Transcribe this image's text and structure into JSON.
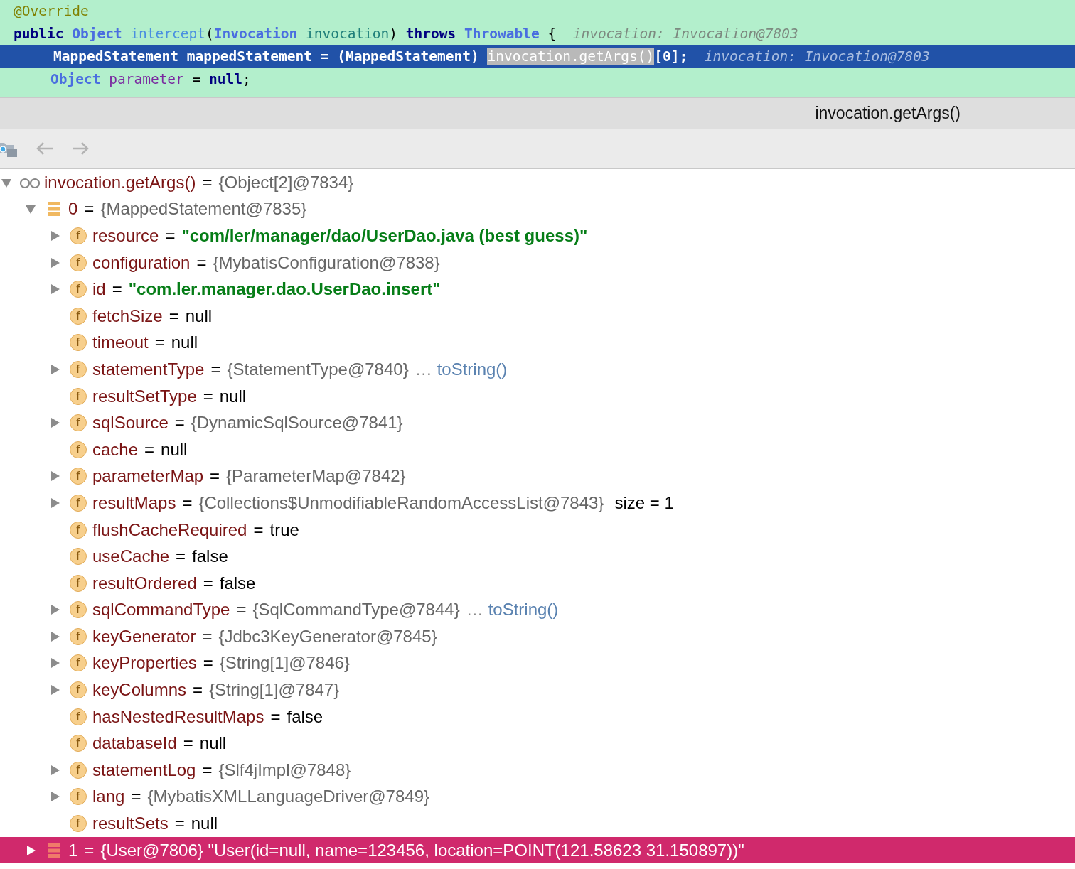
{
  "editor": {
    "lines": [
      {
        "indented": false,
        "selected": false,
        "tokens": [
          {
            "kind": "annotation",
            "text": "@Override"
          }
        ]
      },
      {
        "indented": false,
        "selected": false,
        "tokens": [
          {
            "kind": "keyword",
            "text": "public "
          },
          {
            "kind": "type",
            "text": "Object "
          },
          {
            "kind": "method",
            "text": "intercept"
          },
          {
            "kind": "plain",
            "text": "("
          },
          {
            "kind": "type",
            "text": "Invocation "
          },
          {
            "kind": "param",
            "text": "invocation"
          },
          {
            "kind": "plain",
            "text": ") "
          },
          {
            "kind": "keyword",
            "text": "throws "
          },
          {
            "kind": "type",
            "text": "Throwable"
          },
          {
            "kind": "plain",
            "text": " {  "
          },
          {
            "kind": "hint",
            "text": "invocation: Invocation@7803"
          }
        ]
      },
      {
        "indented": true,
        "selected": true,
        "tokens": [
          {
            "kind": "plain",
            "text": "MappedStatement mappedStatement = (MappedStatement) "
          },
          {
            "kind": "selection",
            "text": "invocation.getArgs()"
          },
          {
            "kind": "plain",
            "text": "[0];  "
          },
          {
            "kind": "hint",
            "text": "invocation: Invocation@7803"
          }
        ]
      },
      {
        "indented": true,
        "selected": false,
        "tokens": [
          {
            "kind": "type",
            "text": "Object "
          },
          {
            "kind": "field",
            "text": "parameter"
          },
          {
            "kind": "plain",
            "text": " = "
          },
          {
            "kind": "keyword",
            "text": "null"
          },
          {
            "kind": "plain",
            "text": ";"
          }
        ]
      }
    ]
  },
  "panel": {
    "title": "invocation.getArgs()"
  },
  "tree": [
    {
      "kind": "watch",
      "name": "invocation.getArgs()",
      "eq": "=",
      "object": "{Object[2]@7834}",
      "expanded": true,
      "selected": false,
      "children": [
        {
          "kind": "array",
          "name": "0",
          "eq": "=",
          "object": "{MappedStatement@7835}",
          "expanded": true,
          "selected": false,
          "children": [
            {
              "kind": "field",
              "badge": "f",
              "name": "resource",
              "eq": "=",
              "string": "\"com/ler/manager/dao/UserDao.java (best guess)\"",
              "expanded": false,
              "selected": false
            },
            {
              "kind": "field",
              "badge": "f",
              "name": "configuration",
              "eq": "=",
              "object": "{MybatisConfiguration@7838}",
              "expanded": false,
              "selected": false
            },
            {
              "kind": "field",
              "badge": "f",
              "name": "id",
              "eq": "=",
              "string": "\"com.ler.manager.dao.UserDao.insert\"",
              "expanded": false,
              "selected": false
            },
            {
              "kind": "field",
              "badge": "f",
              "name": "fetchSize",
              "eq": "=",
              "value": "null",
              "selected": false
            },
            {
              "kind": "field",
              "badge": "f",
              "name": "timeout",
              "eq": "=",
              "value": "null",
              "selected": false
            },
            {
              "kind": "field",
              "badge": "f",
              "name": "statementType",
              "eq": "=",
              "object": "{StatementType@7840}",
              "expanded": false,
              "selected": false,
              "ellipsis": "…",
              "link": "toString()"
            },
            {
              "kind": "field",
              "badge": "f",
              "name": "resultSetType",
              "eq": "=",
              "value": "null",
              "selected": false
            },
            {
              "kind": "field",
              "badge": "f",
              "name": "sqlSource",
              "eq": "=",
              "object": "{DynamicSqlSource@7841}",
              "expanded": false,
              "selected": false
            },
            {
              "kind": "field",
              "badge": "f",
              "name": "cache",
              "eq": "=",
              "value": "null",
              "selected": false
            },
            {
              "kind": "field",
              "badge": "f",
              "name": "parameterMap",
              "eq": "=",
              "object": "{ParameterMap@7842}",
              "expanded": false,
              "selected": false
            },
            {
              "kind": "field",
              "badge": "f",
              "name": "resultMaps",
              "eq": "=",
              "object": "{Collections$UnmodifiableRandomAccessList@7843}",
              "expanded": false,
              "selected": false,
              "size": "size = 1"
            },
            {
              "kind": "field",
              "badge": "f",
              "name": "flushCacheRequired",
              "eq": "=",
              "value": "true",
              "selected": false
            },
            {
              "kind": "field",
              "badge": "f",
              "name": "useCache",
              "eq": "=",
              "value": "false",
              "selected": false
            },
            {
              "kind": "field",
              "badge": "f",
              "name": "resultOrdered",
              "eq": "=",
              "value": "false",
              "selected": false
            },
            {
              "kind": "field",
              "badge": "f",
              "name": "sqlCommandType",
              "eq": "=",
              "object": "{SqlCommandType@7844}",
              "expanded": false,
              "selected": false,
              "ellipsis": "…",
              "link": "toString()"
            },
            {
              "kind": "field",
              "badge": "f",
              "name": "keyGenerator",
              "eq": "=",
              "object": "{Jdbc3KeyGenerator@7845}",
              "expanded": false,
              "selected": false
            },
            {
              "kind": "field",
              "badge": "f",
              "name": "keyProperties",
              "eq": "=",
              "object": "{String[1]@7846}",
              "expanded": false,
              "selected": false
            },
            {
              "kind": "field",
              "badge": "f",
              "name": "keyColumns",
              "eq": "=",
              "object": "{String[1]@7847}",
              "expanded": false,
              "selected": false
            },
            {
              "kind": "field",
              "badge": "f",
              "name": "hasNestedResultMaps",
              "eq": "=",
              "value": "false",
              "selected": false
            },
            {
              "kind": "field",
              "badge": "f",
              "name": "databaseId",
              "eq": "=",
              "value": "null",
              "selected": false
            },
            {
              "kind": "field",
              "badge": "f",
              "name": "statementLog",
              "eq": "=",
              "object": "{Slf4jImpl@7848}",
              "expanded": false,
              "selected": false
            },
            {
              "kind": "field",
              "badge": "f",
              "name": "lang",
              "eq": "=",
              "object": "{MybatisXMLLanguageDriver@7849}",
              "expanded": false,
              "selected": false
            },
            {
              "kind": "field",
              "badge": "f",
              "name": "resultSets",
              "eq": "=",
              "value": "null",
              "selected": false
            }
          ]
        },
        {
          "kind": "array",
          "name": "1",
          "eq": "=",
          "object": "{User@7806} \"User(id=null, name=123456, location=POINT(121.58623 31.150897))\"",
          "expanded": false,
          "selected": true
        }
      ]
    }
  ]
}
